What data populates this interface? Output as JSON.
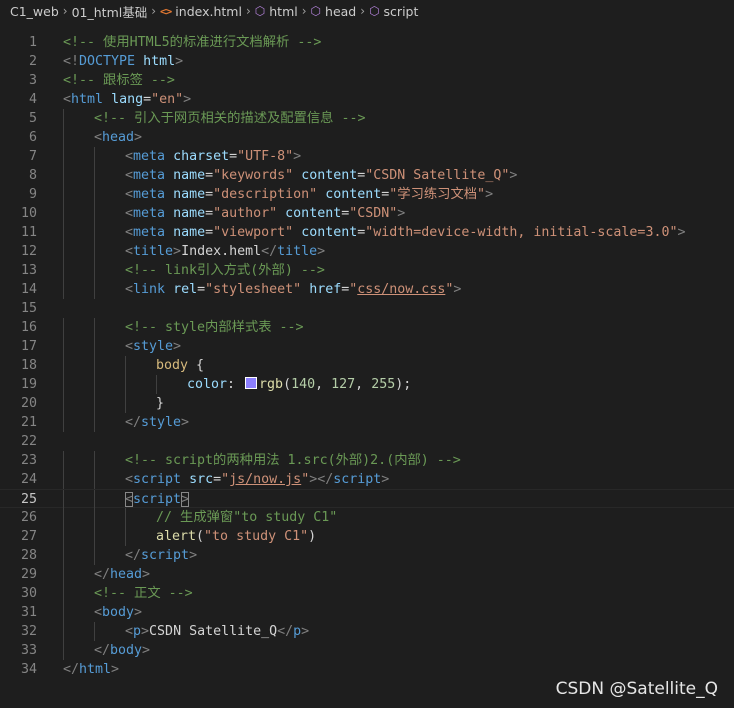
{
  "breadcrumb": [
    {
      "label": "C1_web",
      "icon": ""
    },
    {
      "label": "01_html基础",
      "icon": ""
    },
    {
      "label": "index.html",
      "icon": "html-file-icon"
    },
    {
      "label": "html",
      "icon": "element-cube-icon"
    },
    {
      "label": "head",
      "icon": "element-cube-icon"
    },
    {
      "label": "script",
      "icon": "element-cube-icon"
    }
  ],
  "editor": {
    "active_line": 25,
    "lines": [
      {
        "n": "1",
        "indent": 0,
        "tokens": [
          [
            "c",
            "<!-- 使用HTML5的标准进行文档解析 -->"
          ]
        ]
      },
      {
        "n": "2",
        "indent": 0,
        "tokens": [
          [
            "p",
            "<!"
          ],
          [
            "tg",
            "DOCTYPE"
          ],
          [
            "tx",
            " "
          ],
          [
            "at",
            "html"
          ],
          [
            "p",
            ">"
          ]
        ]
      },
      {
        "n": "3",
        "indent": 0,
        "tokens": [
          [
            "c",
            "<!-- 跟标签 -->"
          ]
        ]
      },
      {
        "n": "4",
        "indent": 0,
        "tokens": [
          [
            "p",
            "<"
          ],
          [
            "tg",
            "html"
          ],
          [
            "tx",
            " "
          ],
          [
            "at",
            "lang"
          ],
          [
            "tx",
            "="
          ],
          [
            "st",
            "\"en\""
          ],
          [
            "p",
            ">"
          ]
        ]
      },
      {
        "n": "5",
        "indent": 1,
        "tokens": [
          [
            "c",
            "<!-- 引入于网页相关的描述及配置信息 -->"
          ]
        ]
      },
      {
        "n": "6",
        "indent": 1,
        "tokens": [
          [
            "p",
            "<"
          ],
          [
            "tg",
            "head"
          ],
          [
            "p",
            ">"
          ]
        ]
      },
      {
        "n": "7",
        "indent": 2,
        "tokens": [
          [
            "p",
            "<"
          ],
          [
            "tg",
            "meta"
          ],
          [
            "tx",
            " "
          ],
          [
            "at",
            "charset"
          ],
          [
            "tx",
            "="
          ],
          [
            "st",
            "\"UTF-8\""
          ],
          [
            "p",
            ">"
          ]
        ]
      },
      {
        "n": "8",
        "indent": 2,
        "tokens": [
          [
            "p",
            "<"
          ],
          [
            "tg",
            "meta"
          ],
          [
            "tx",
            " "
          ],
          [
            "at",
            "name"
          ],
          [
            "tx",
            "="
          ],
          [
            "st",
            "\"keywords\""
          ],
          [
            "tx",
            " "
          ],
          [
            "at",
            "content"
          ],
          [
            "tx",
            "="
          ],
          [
            "st",
            "\"CSDN Satellite_Q\""
          ],
          [
            "p",
            ">"
          ]
        ]
      },
      {
        "n": "9",
        "indent": 2,
        "tokens": [
          [
            "p",
            "<"
          ],
          [
            "tg",
            "meta"
          ],
          [
            "tx",
            " "
          ],
          [
            "at",
            "name"
          ],
          [
            "tx",
            "="
          ],
          [
            "st",
            "\"description\""
          ],
          [
            "tx",
            " "
          ],
          [
            "at",
            "content"
          ],
          [
            "tx",
            "="
          ],
          [
            "st",
            "\"学习练习文档\""
          ],
          [
            "p",
            ">"
          ]
        ]
      },
      {
        "n": "10",
        "indent": 2,
        "tokens": [
          [
            "p",
            "<"
          ],
          [
            "tg",
            "meta"
          ],
          [
            "tx",
            " "
          ],
          [
            "at",
            "name"
          ],
          [
            "tx",
            "="
          ],
          [
            "st",
            "\"author\""
          ],
          [
            "tx",
            " "
          ],
          [
            "at",
            "content"
          ],
          [
            "tx",
            "="
          ],
          [
            "st",
            "\"CSDN\""
          ],
          [
            "p",
            ">"
          ]
        ]
      },
      {
        "n": "11",
        "indent": 2,
        "tokens": [
          [
            "p",
            "<"
          ],
          [
            "tg",
            "meta"
          ],
          [
            "tx",
            " "
          ],
          [
            "at",
            "name"
          ],
          [
            "tx",
            "="
          ],
          [
            "st",
            "\"viewport\""
          ],
          [
            "tx",
            " "
          ],
          [
            "at",
            "content"
          ],
          [
            "tx",
            "="
          ],
          [
            "st",
            "\"width=device-width, initial-scale=3.0\""
          ],
          [
            "p",
            ">"
          ]
        ]
      },
      {
        "n": "12",
        "indent": 2,
        "tokens": [
          [
            "p",
            "<"
          ],
          [
            "tg",
            "title"
          ],
          [
            "p",
            ">"
          ],
          [
            "tx",
            "Index.heml"
          ],
          [
            "p",
            "</"
          ],
          [
            "tg",
            "title"
          ],
          [
            "p",
            ">"
          ]
        ]
      },
      {
        "n": "13",
        "indent": 2,
        "tokens": [
          [
            "c",
            "<!-- link引入方式(外部) -->"
          ]
        ]
      },
      {
        "n": "14",
        "indent": 2,
        "tokens": [
          [
            "p",
            "<"
          ],
          [
            "tg",
            "link"
          ],
          [
            "tx",
            " "
          ],
          [
            "at",
            "rel"
          ],
          [
            "tx",
            "="
          ],
          [
            "st",
            "\"stylesheet\""
          ],
          [
            "tx",
            " "
          ],
          [
            "at",
            "href"
          ],
          [
            "tx",
            "="
          ],
          [
            "st",
            "\""
          ],
          [
            "stu",
            "css/now.css"
          ],
          [
            "st",
            "\""
          ],
          [
            "p",
            ">"
          ]
        ]
      },
      {
        "n": "15",
        "indent": 0,
        "tokens": []
      },
      {
        "n": "16",
        "indent": 2,
        "tokens": [
          [
            "c",
            "<!-- style内部样式表 -->"
          ]
        ]
      },
      {
        "n": "17",
        "indent": 2,
        "tokens": [
          [
            "p",
            "<"
          ],
          [
            "tg",
            "style"
          ],
          [
            "p",
            ">"
          ]
        ]
      },
      {
        "n": "18",
        "indent": 3,
        "tokens": [
          [
            "sl",
            "body"
          ],
          [
            "tx",
            " {"
          ]
        ]
      },
      {
        "n": "19",
        "indent": 4,
        "tokens": [
          [
            "pr",
            "color"
          ],
          [
            "tx",
            ": "
          ],
          [
            "sw",
            "#8c7fff"
          ],
          [
            "fn",
            "rgb"
          ],
          [
            "tx",
            "("
          ],
          [
            "nm",
            "140"
          ],
          [
            "tx",
            ", "
          ],
          [
            "nm",
            "127"
          ],
          [
            "tx",
            ", "
          ],
          [
            "nm",
            "255"
          ],
          [
            "tx",
            ");"
          ]
        ]
      },
      {
        "n": "20",
        "indent": 3,
        "tokens": [
          [
            "tx",
            "}"
          ]
        ]
      },
      {
        "n": "21",
        "indent": 2,
        "tokens": [
          [
            "p",
            "</"
          ],
          [
            "tg",
            "style"
          ],
          [
            "p",
            ">"
          ]
        ]
      },
      {
        "n": "22",
        "indent": 0,
        "tokens": []
      },
      {
        "n": "23",
        "indent": 2,
        "tokens": [
          [
            "c",
            "<!-- script的两种用法 1.src(外部)2.(内部) -->"
          ]
        ]
      },
      {
        "n": "24",
        "indent": 2,
        "tokens": [
          [
            "p",
            "<"
          ],
          [
            "tg",
            "script"
          ],
          [
            "tx",
            " "
          ],
          [
            "at",
            "src"
          ],
          [
            "tx",
            "="
          ],
          [
            "st",
            "\""
          ],
          [
            "stu",
            "js/now.js"
          ],
          [
            "st",
            "\""
          ],
          [
            "p",
            ">"
          ],
          [
            "p",
            "</"
          ],
          [
            "tg",
            "script"
          ],
          [
            "p",
            ">"
          ]
        ]
      },
      {
        "n": "25",
        "indent": 2,
        "tokens": [
          [
            "pb",
            "<"
          ],
          [
            "tg",
            "script"
          ],
          [
            "pb",
            ">"
          ]
        ]
      },
      {
        "n": "26",
        "indent": 3,
        "tokens": [
          [
            "c",
            "// 生成弹窗\"to study C1\""
          ]
        ]
      },
      {
        "n": "27",
        "indent": 3,
        "tokens": [
          [
            "fn",
            "alert"
          ],
          [
            "tx",
            "("
          ],
          [
            "st",
            "\"to study C1\""
          ],
          [
            "tx",
            ")"
          ]
        ]
      },
      {
        "n": "28",
        "indent": 2,
        "tokens": [
          [
            "p",
            "</"
          ],
          [
            "tg",
            "script"
          ],
          [
            "p",
            ">"
          ]
        ]
      },
      {
        "n": "29",
        "indent": 1,
        "tokens": [
          [
            "p",
            "</"
          ],
          [
            "tg",
            "head"
          ],
          [
            "p",
            ">"
          ]
        ]
      },
      {
        "n": "30",
        "indent": 1,
        "tokens": [
          [
            "c",
            "<!-- 正文 -->"
          ]
        ]
      },
      {
        "n": "31",
        "indent": 1,
        "tokens": [
          [
            "p",
            "<"
          ],
          [
            "tg",
            "body"
          ],
          [
            "p",
            ">"
          ]
        ]
      },
      {
        "n": "32",
        "indent": 2,
        "tokens": [
          [
            "p",
            "<"
          ],
          [
            "tg",
            "p"
          ],
          [
            "p",
            ">"
          ],
          [
            "tx",
            "CSDN Satellite_Q"
          ],
          [
            "p",
            "</"
          ],
          [
            "tg",
            "p"
          ],
          [
            "p",
            ">"
          ]
        ]
      },
      {
        "n": "33",
        "indent": 1,
        "tokens": [
          [
            "p",
            "</"
          ],
          [
            "tg",
            "body"
          ],
          [
            "p",
            ">"
          ]
        ]
      },
      {
        "n": "34",
        "indent": 0,
        "tokens": [
          [
            "p",
            "</"
          ],
          [
            "tg",
            "html"
          ],
          [
            "p",
            ">"
          ]
        ]
      }
    ]
  },
  "watermark": "CSDN @Satellite_Q"
}
